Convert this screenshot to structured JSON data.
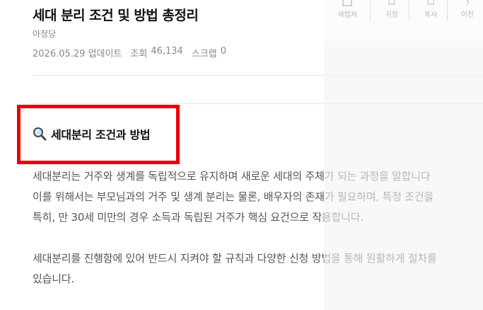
{
  "article": {
    "title": "세대 분리 조건 및 방법 총정리",
    "author": "아정당",
    "meta": {
      "date": "2026.05.29 업데이트",
      "views_label": "조회",
      "views_value": "46,134",
      "scrap_label": "스크랩",
      "scrap_value": "0"
    },
    "section_heading": "세대분리 조건과 방법",
    "section_icon": "magnifier-icon",
    "paragraph1": [
      "세대분리는 거주와 생계를 독립적으로 유지하며 새로운 세대의 주체가 되는 과정을 말합니다",
      "이를 위해서는 부모님과의 거주 및 생계 분리는 물론, 배우자의 존재가 필요하며, 특정 조건을",
      "특히, 만 30세 미만의 경우 소득과 독립된 거주가 핵심 요건으로 작용합니다."
    ],
    "paragraph2": [
      "세대분리를 진행함에 있어 반드시 지켜야 할 규칙과 다양한 신청 방법을 통해 원활하게 절차를",
      "있습니다."
    ]
  },
  "toolbar": {
    "items": [
      {
        "label": "새캡쳐",
        "icon": "capture-icon"
      },
      {
        "label": "저장",
        "icon": "save-icon"
      },
      {
        "label": "복사",
        "icon": "copy-icon"
      },
      {
        "label": "이전",
        "icon": "undo-icon"
      }
    ]
  },
  "colors": {
    "highlight": "#ee0000",
    "title": "#111111",
    "body": "#555555",
    "meta": "#888888"
  }
}
